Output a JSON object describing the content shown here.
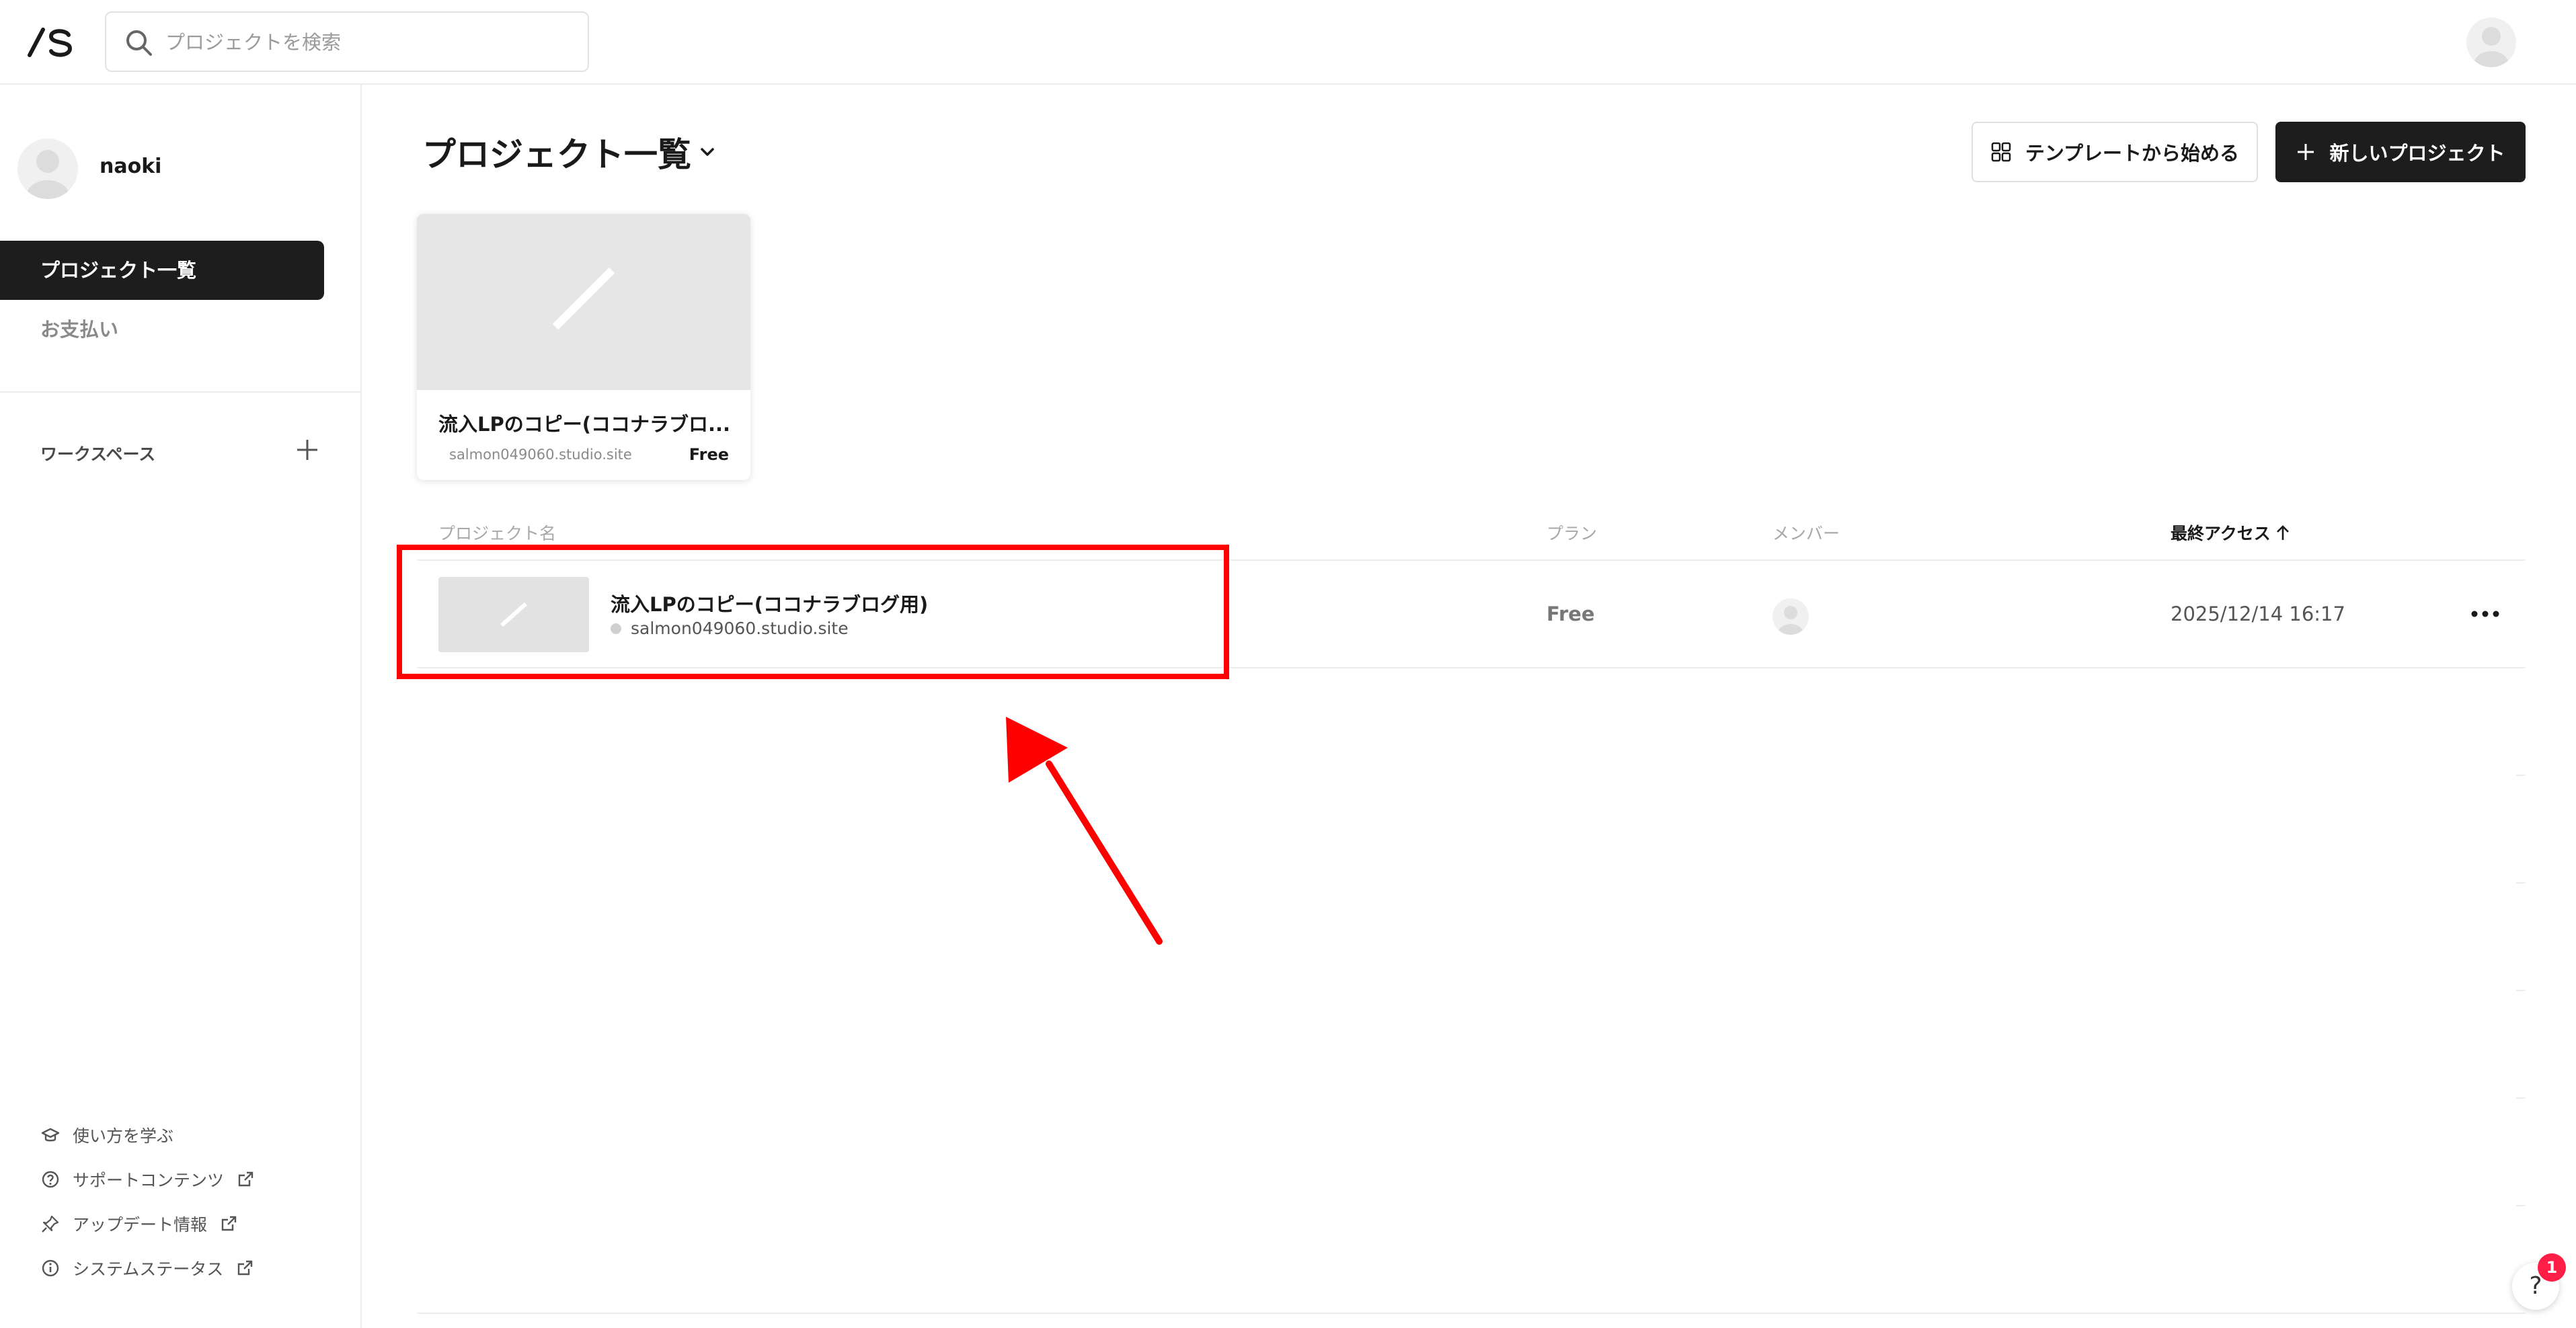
{
  "topbar": {
    "search_placeholder": "プロジェクトを検索"
  },
  "sidebar": {
    "user_name": "naoki",
    "nav": [
      {
        "label": "プロジェクト一覧",
        "active": true
      },
      {
        "label": "お支払い",
        "active": false
      }
    ],
    "workspace_label": "ワークスペース",
    "footer_links": [
      {
        "label": "使い方を学ぶ",
        "icon": "graduation-cap-icon",
        "external": false
      },
      {
        "label": "サポートコンテンツ",
        "icon": "question-circle-icon",
        "external": true
      },
      {
        "label": "アップデート情報",
        "icon": "pin-icon",
        "external": true
      },
      {
        "label": "システムステータス",
        "icon": "info-circle-icon",
        "external": true
      }
    ]
  },
  "main": {
    "title": "プロジェクト一覧",
    "template_button": "テンプレートから始める",
    "new_project_button": "新しいプロジェクト",
    "card": {
      "title": "流入LPのコピー(ココナラブロ...",
      "url": "salmon049060.studio.site",
      "plan": "Free"
    },
    "table": {
      "headers": {
        "name": "プロジェクト名",
        "plan": "プラン",
        "members": "メンバー",
        "last_access": "最終アクセス"
      },
      "rows": [
        {
          "name": "流入LPのコピー(ココナラブログ用)",
          "url": "salmon049060.studio.site",
          "plan": "Free",
          "last_access": "2025/12/14 16:17"
        }
      ]
    }
  },
  "help": {
    "label": "?",
    "badge_count": "1"
  },
  "colors": {
    "accent_dark": "#1d1d1d",
    "annotation_red": "#ff0000",
    "badge_red": "#ff1e45"
  }
}
